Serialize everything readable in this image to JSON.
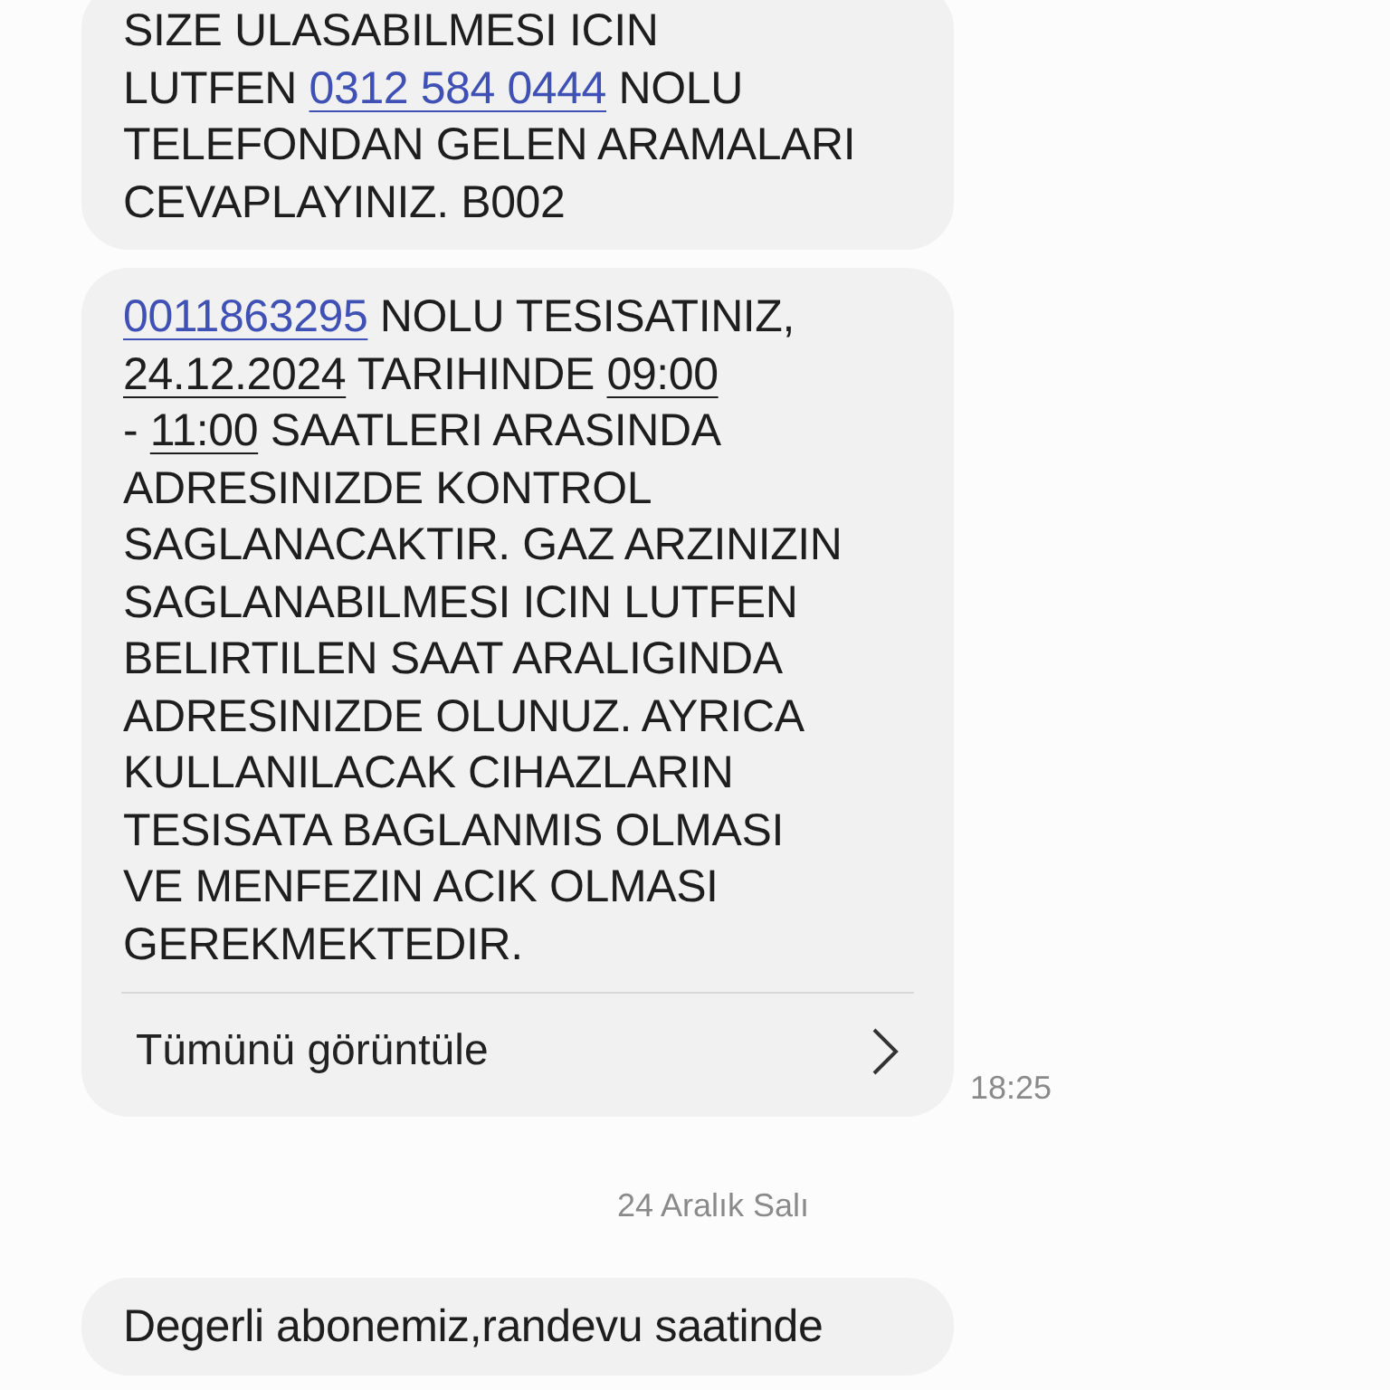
{
  "messages": [
    {
      "kind": "message",
      "lines": [
        [
          {
            "kind": "text",
            "text": "SIZE ULASABILMESI ICIN"
          }
        ],
        [
          {
            "kind": "text",
            "text": "LUTFEN "
          },
          {
            "kind": "phone",
            "text": "0312 584 0444"
          },
          {
            "kind": "text",
            "text": " NOLU"
          }
        ],
        [
          {
            "kind": "text",
            "text": "TELEFONDAN GELEN ARAMALARI"
          }
        ],
        [
          {
            "kind": "text",
            "text": "CEVAPLAYINIZ. B002"
          }
        ]
      ]
    },
    {
      "kind": "message",
      "lines": [
        [
          {
            "kind": "phone",
            "text": "0011863295"
          },
          {
            "kind": "text",
            "text": " NOLU TESISATINIZ,"
          }
        ],
        [
          {
            "kind": "date",
            "text": "24.12.2024"
          },
          {
            "kind": "text",
            "text": " TARIHINDE "
          },
          {
            "kind": "date",
            "text": "09:00"
          }
        ],
        [
          {
            "kind": "text",
            "text": "- "
          },
          {
            "kind": "date",
            "text": "11:00"
          },
          {
            "kind": "text",
            "text": " SAATLERI ARASINDA"
          }
        ],
        [
          {
            "kind": "text",
            "text": "ADRESINIZDE KONTROL"
          }
        ],
        [
          {
            "kind": "text",
            "text": "SAGLANACAKTIR. GAZ ARZINIZIN"
          }
        ],
        [
          {
            "kind": "text",
            "text": "SAGLANABILMESI ICIN LUTFEN"
          }
        ],
        [
          {
            "kind": "text",
            "text": "BELIRTILEN SAAT ARALIGINDA"
          }
        ],
        [
          {
            "kind": "text",
            "text": "ADRESINIZDE OLUNUZ. AYRICA"
          }
        ],
        [
          {
            "kind": "text",
            "text": "KULLANILACAK CIHAZLARIN"
          }
        ],
        [
          {
            "kind": "text",
            "text": "TESISATA BAGLANMIS OLMASI"
          }
        ],
        [
          {
            "kind": "text",
            "text": "VE MENFEZIN ACIK OLMASI"
          }
        ],
        [
          {
            "kind": "text",
            "text": "GEREKMEKTEDIR."
          }
        ]
      ],
      "view_all": "Tümünü görüntüle",
      "time": "18:25"
    },
    {
      "kind": "date_separator",
      "text": "24 Aralık Salı"
    },
    {
      "kind": "message",
      "lines": [
        [
          {
            "kind": "text",
            "text": "Degerli abonemiz,randevu saatinde"
          }
        ]
      ]
    }
  ]
}
